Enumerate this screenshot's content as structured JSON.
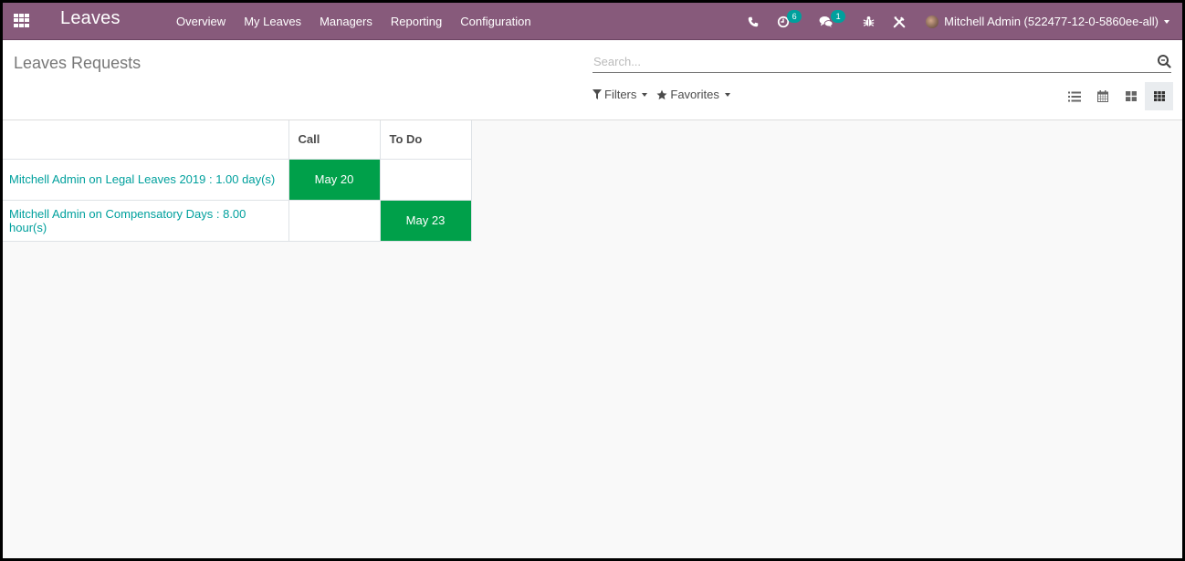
{
  "navbar": {
    "brand": "Leaves",
    "menu": [
      "Overview",
      "My Leaves",
      "Managers",
      "Reporting",
      "Configuration"
    ],
    "activity_count": "6",
    "messages_count": "1",
    "user_name": "Mitchell Admin (522477-12-0-5860ee-all)",
    "colors": {
      "bar": "#875a7b",
      "badge": "#00a09d"
    }
  },
  "control_panel": {
    "title": "Leaves Requests",
    "search_placeholder": "Search...",
    "filters_label": "Filters",
    "favorites_label": "Favorites",
    "views": [
      "list",
      "calendar",
      "kanban",
      "activity"
    ],
    "active_view": "activity"
  },
  "activity_table": {
    "columns": [
      "Call",
      "To Do"
    ],
    "rows": [
      {
        "name": "Mitchell Admin on Legal Leaves 2019 : 1.00 day(s)",
        "cells": [
          "May 20",
          ""
        ]
      },
      {
        "name": "Mitchell Admin on Compensatory Days : 8.00 hour(s)",
        "cells": [
          "",
          "May 23"
        ]
      }
    ],
    "colors": {
      "link": "#00a09d",
      "planned": "#00a04a"
    }
  }
}
